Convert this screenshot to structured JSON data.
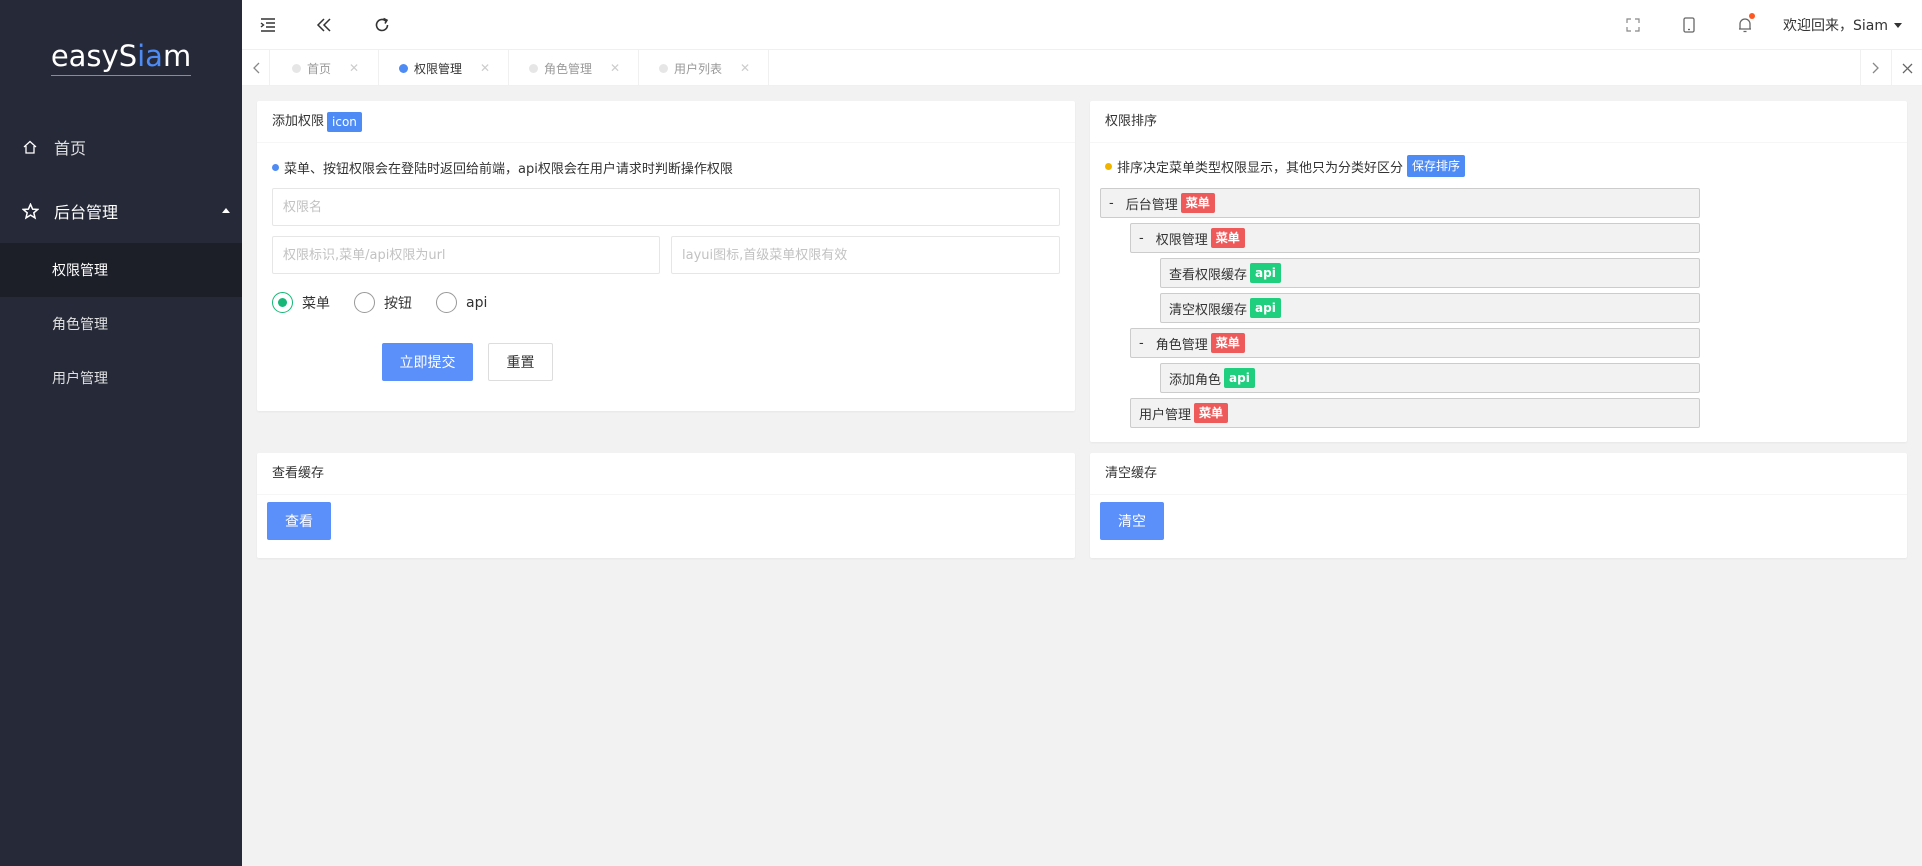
{
  "app": {
    "logo_left": "easyS",
    "logo_accent": "ia",
    "logo_right": "m"
  },
  "sidebar": {
    "items": [
      {
        "label": "首页",
        "icon": "home-icon"
      },
      {
        "label": "后台管理",
        "icon": "star-icon"
      }
    ],
    "sub_items": [
      {
        "label": "权限管理",
        "active": true
      },
      {
        "label": "角色管理"
      },
      {
        "label": "用户管理"
      }
    ]
  },
  "header": {
    "user_label": "欢迎回来，Siam",
    "icons": [
      "menu-fold-icon",
      "double-left-icon",
      "refresh-icon",
      "fullscreen-icon",
      "mobile-icon",
      "bell-icon"
    ]
  },
  "tabs": [
    {
      "label": "首页"
    },
    {
      "label": "权限管理",
      "active": true
    },
    {
      "label": "角色管理"
    },
    {
      "label": "用户列表"
    }
  ],
  "add_card": {
    "title": "添加权限",
    "badge": "icon",
    "note": "菜单、按钮权限会在登陆时返回给前端，api权限会在用户请求时判断操作权限",
    "name_placeholder": "权限名",
    "ident_placeholder": "权限标识,菜单/api权限为url",
    "icon_placeholder": "layui图标,首级菜单权限有效",
    "radios": [
      "菜单",
      "按钮",
      "api"
    ],
    "selected_radio": "菜单",
    "submit": "立即提交",
    "reset": "重置"
  },
  "sort_card": {
    "title": "权限排序",
    "note": "排序决定菜单类型权限显示，其他只为分类好区分",
    "save_badge": "保存排序",
    "tree": [
      {
        "mark": "-",
        "label": "后台管理",
        "tag": "菜单",
        "tag_type": "menu"
      },
      {
        "mark": "-",
        "label": "权限管理",
        "tag": "菜单",
        "tag_type": "menu"
      },
      {
        "label": "查看权限缓存",
        "tag": "api",
        "tag_type": "api"
      },
      {
        "label": "清空权限缓存",
        "tag": "api",
        "tag_type": "api"
      },
      {
        "mark": "-",
        "label": "角色管理",
        "tag": "菜单",
        "tag_type": "menu"
      },
      {
        "label": "添加角色",
        "tag": "api",
        "tag_type": "api"
      },
      {
        "label": "用户管理",
        "tag": "菜单",
        "tag_type": "menu"
      }
    ]
  },
  "view_cache": {
    "title": "查看缓存",
    "button": "查看"
  },
  "clear_cache": {
    "title": "清空缓存",
    "button": "清空"
  },
  "colors": {
    "sidebar_bg": "#262937",
    "primary": "#5b8ff9",
    "menu_tag": "#ee5a5a",
    "api_tag": "#1fcf7d",
    "radio_on": "#16b777"
  }
}
